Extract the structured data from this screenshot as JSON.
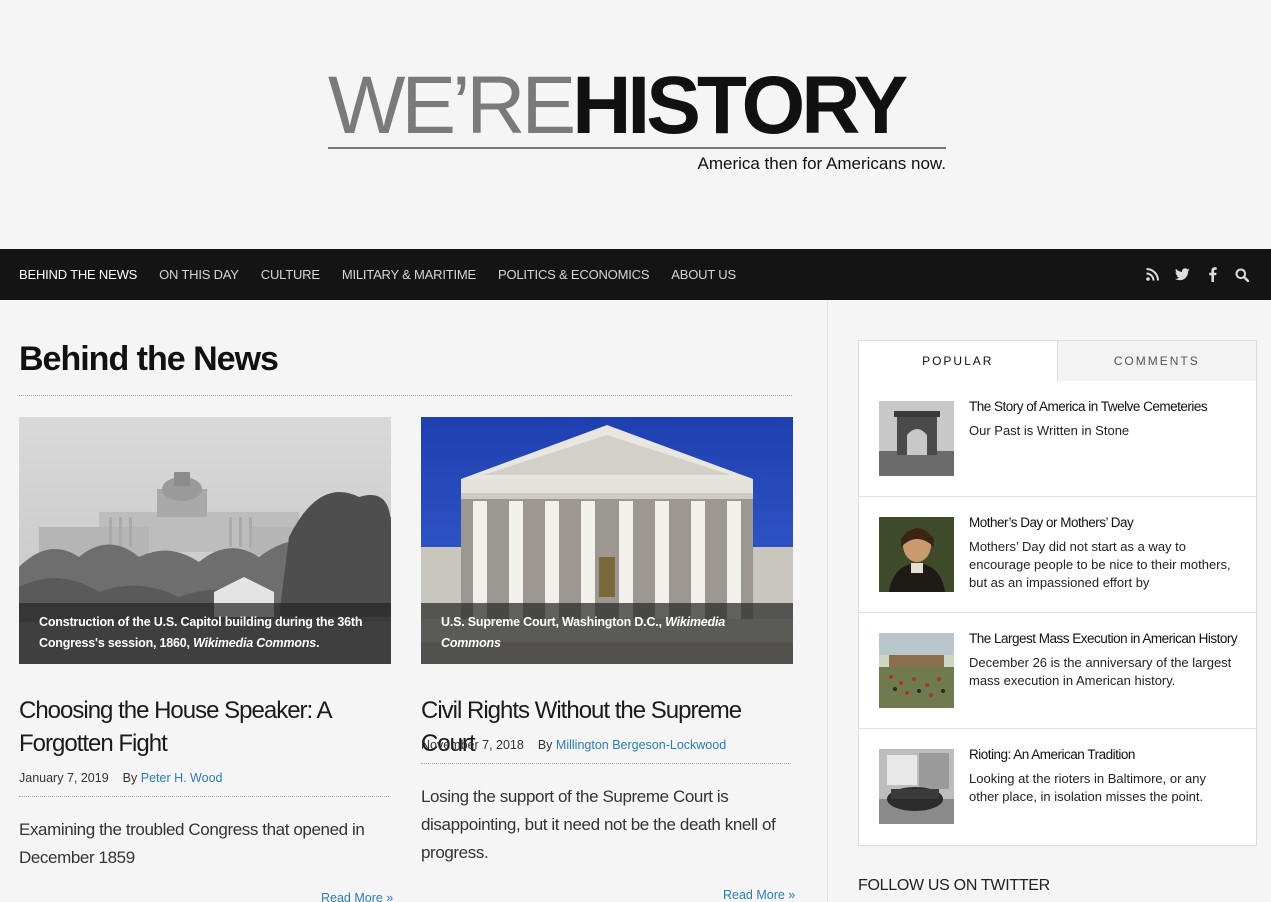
{
  "logo": {
    "part1": "WE’RE",
    "part2": "HISTORY",
    "tagline": "America then for Americans now."
  },
  "nav": {
    "items": [
      {
        "label": "BEHIND THE NEWS",
        "active": true
      },
      {
        "label": "ON THIS DAY"
      },
      {
        "label": "CULTURE"
      },
      {
        "label": "MILITARY & MARITIME"
      },
      {
        "label": "POLITICS & ECONOMICS"
      },
      {
        "label": "ABOUT US"
      }
    ],
    "icons": [
      "rss-icon",
      "twitter-icon",
      "facebook-icon",
      "search-icon"
    ]
  },
  "section": {
    "title": "Behind the News"
  },
  "articles": [
    {
      "caption": "Construction of the U.S. Capitol building during the 36th Congress's session, 1860, ",
      "caption_source": "Wikimedia Commons",
      "caption_end": ".",
      "title": "Choosing the House Speaker: A Forgotten Fight",
      "date": "January 7, 2019",
      "by": "By",
      "author": "Peter H. Wood",
      "excerpt": "Examining the troubled Congress that opened in December 1859",
      "read_more": "Read More »"
    },
    {
      "caption": "U.S. Supreme Court, Washington D.C., ",
      "caption_source": "Wikimedia Commons",
      "caption_end": "",
      "title": "Civil Rights Without the Supreme Court",
      "date": "November 7, 2018",
      "by": "By",
      "author": "Millington Bergeson-Lockwood",
      "excerpt": "Losing the support of the Supreme Court is disappointing, but it need not be the death knell of progress.",
      "read_more": "Read More »"
    }
  ],
  "sidebar": {
    "tabs": [
      "POPULAR",
      "COMMENTS"
    ],
    "popular": [
      {
        "title": "The Story of America in Twelve Cemeteries",
        "desc": "Our Past is Written in Stone"
      },
      {
        "title": "Mother’s Day or Mothers’ Day",
        "desc": "Mothers’ Day did not start as a way to encourage people to be nice to their mothers, but as an impassioned effort by"
      },
      {
        "title": "The Largest Mass Execution in American History",
        "desc": "December 26 is the anniversary of the largest mass execution in American history."
      },
      {
        "title": "Rioting: An American Tradition",
        "desc": "Looking at the rioters in Baltimore, or any other place, in isolation misses the point."
      }
    ],
    "follow": "FOLLOW US ON TWITTER"
  },
  "colors": {
    "nav_bg": "#141414",
    "link": "#2a7db9",
    "page_bg": "#f5f5f5"
  }
}
